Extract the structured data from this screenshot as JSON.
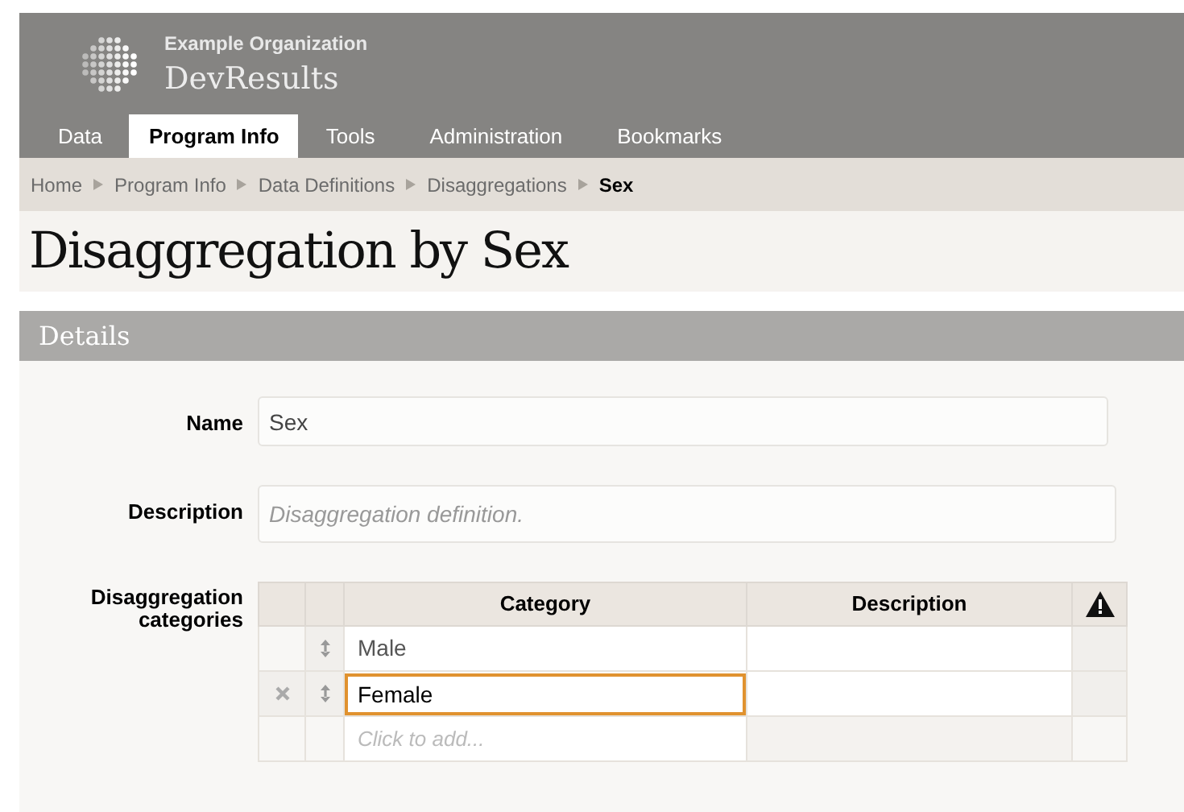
{
  "header": {
    "organization": "Example Organization",
    "product": "DevResults"
  },
  "tabs": [
    {
      "label": "Data",
      "selected": false
    },
    {
      "label": "Program Info",
      "selected": true
    },
    {
      "label": "Tools",
      "selected": false
    },
    {
      "label": "Administration",
      "selected": false
    },
    {
      "label": "Bookmarks",
      "selected": false
    }
  ],
  "breadcrumbs": [
    {
      "label": "Home",
      "current": false
    },
    {
      "label": "Program Info",
      "current": false
    },
    {
      "label": "Data Definitions",
      "current": false
    },
    {
      "label": "Disaggregations",
      "current": false
    },
    {
      "label": "Sex",
      "current": true
    }
  ],
  "page_title": "Disaggregation by Sex",
  "section_title": "Details",
  "fields": {
    "name": {
      "label": "Name",
      "value": "Sex"
    },
    "description": {
      "label": "Description",
      "placeholder": "Disaggregation definition."
    }
  },
  "categories": {
    "label": "Disaggregation categories",
    "columns": [
      "Category",
      "Description"
    ],
    "rows": [
      {
        "category": "Male",
        "selected": false
      },
      {
        "category": "Female",
        "selected": true
      }
    ],
    "add_placeholder": "Click to add..."
  }
}
